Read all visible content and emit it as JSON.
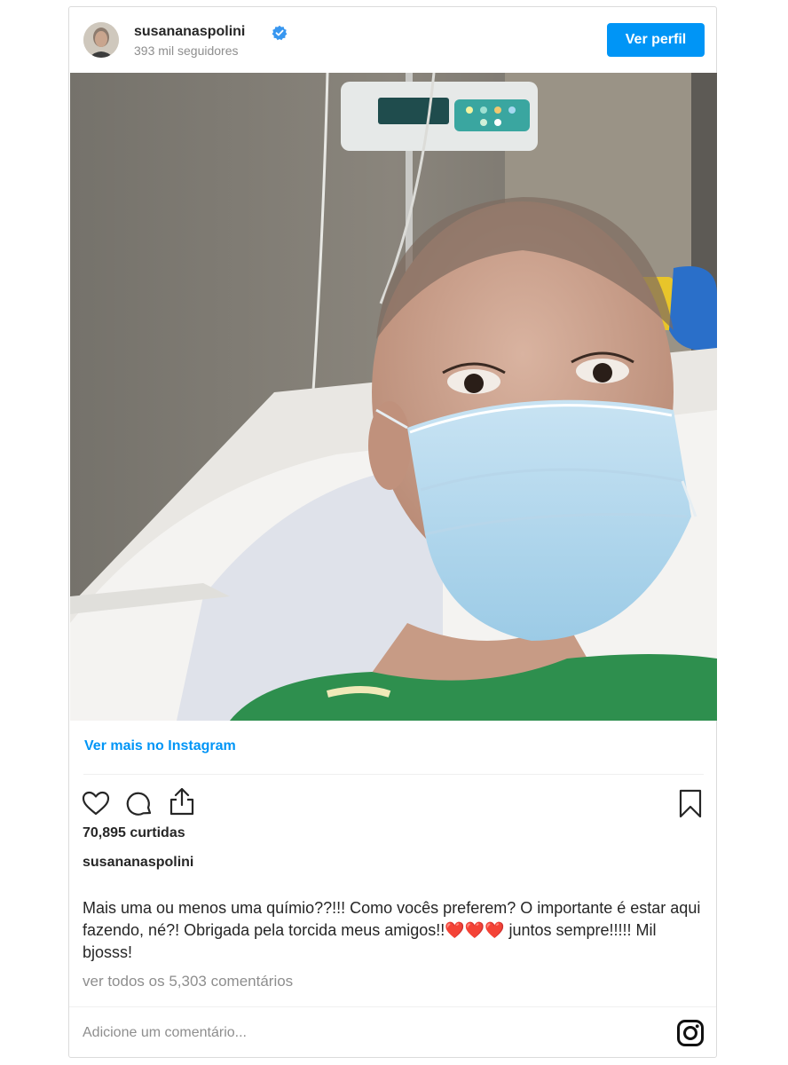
{
  "header": {
    "username": "susananaspolini",
    "verified": true,
    "followers": "393 mil seguidores",
    "profile_button": "Ver perfil"
  },
  "post": {
    "photo_alt_icon": "hospital-selfie-photo"
  },
  "more_link": "Ver mais no Instagram",
  "actions": {
    "like": "heart-icon",
    "comment": "comment-icon",
    "share": "share-icon",
    "save": "bookmark-icon"
  },
  "likes": "70,895 curtidas",
  "caption": {
    "username": "susananaspolini",
    "text": "Mais uma ou menos uma químio??!!! Como vocês preferem? O importante é estar aqui fazendo, né?! Obrigada pela torcida meus amigos!!❤️❤️❤️ juntos sempre!!!!! Mil bjosss!"
  },
  "comments_link": "ver todos os 5,303 comentários",
  "comment_box": {
    "placeholder": "Adicione um comentário..."
  },
  "colors": {
    "accent": "#0095f6",
    "text": "#262626",
    "muted": "#8e8e8e"
  }
}
